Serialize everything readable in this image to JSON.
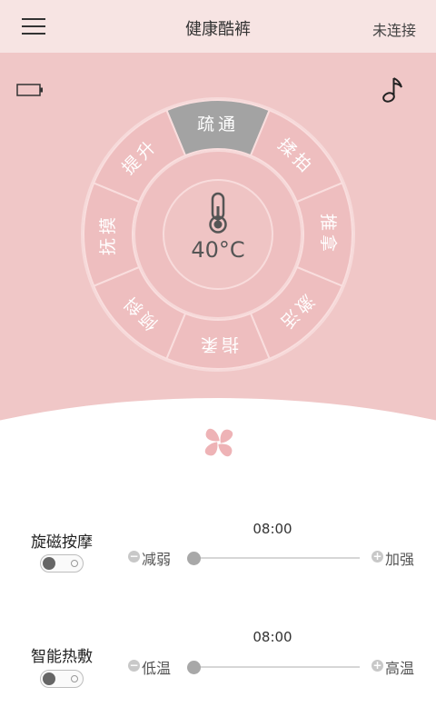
{
  "header": {
    "title": "健康酷裤",
    "status": "未连接"
  },
  "wheel": {
    "center_temperature": "40°C",
    "selected": "疏通",
    "segments": [
      "疏通",
      "揉拍",
      "推拿",
      "激活",
      "指柔",
      "倾斜",
      "抚摸",
      "提升"
    ]
  },
  "controls": [
    {
      "label": "旋磁按摩",
      "time": "08:00",
      "min_label": "减弱",
      "max_label": "加强",
      "enabled": false,
      "level": 0
    },
    {
      "label": "智能热敷",
      "time": "08:00",
      "min_label": "低温",
      "max_label": "高温",
      "enabled": false,
      "level": 0
    }
  ],
  "colors": {
    "panel": "#f0c7c7",
    "selected_segment": "#a3a3a3",
    "accent": "#e8a6ab"
  },
  "icons": {
    "menu": "menu-icon",
    "battery": "battery-icon",
    "music": "music-note-icon",
    "thermometer": "thermometer-icon",
    "clover": "clover-icon"
  }
}
